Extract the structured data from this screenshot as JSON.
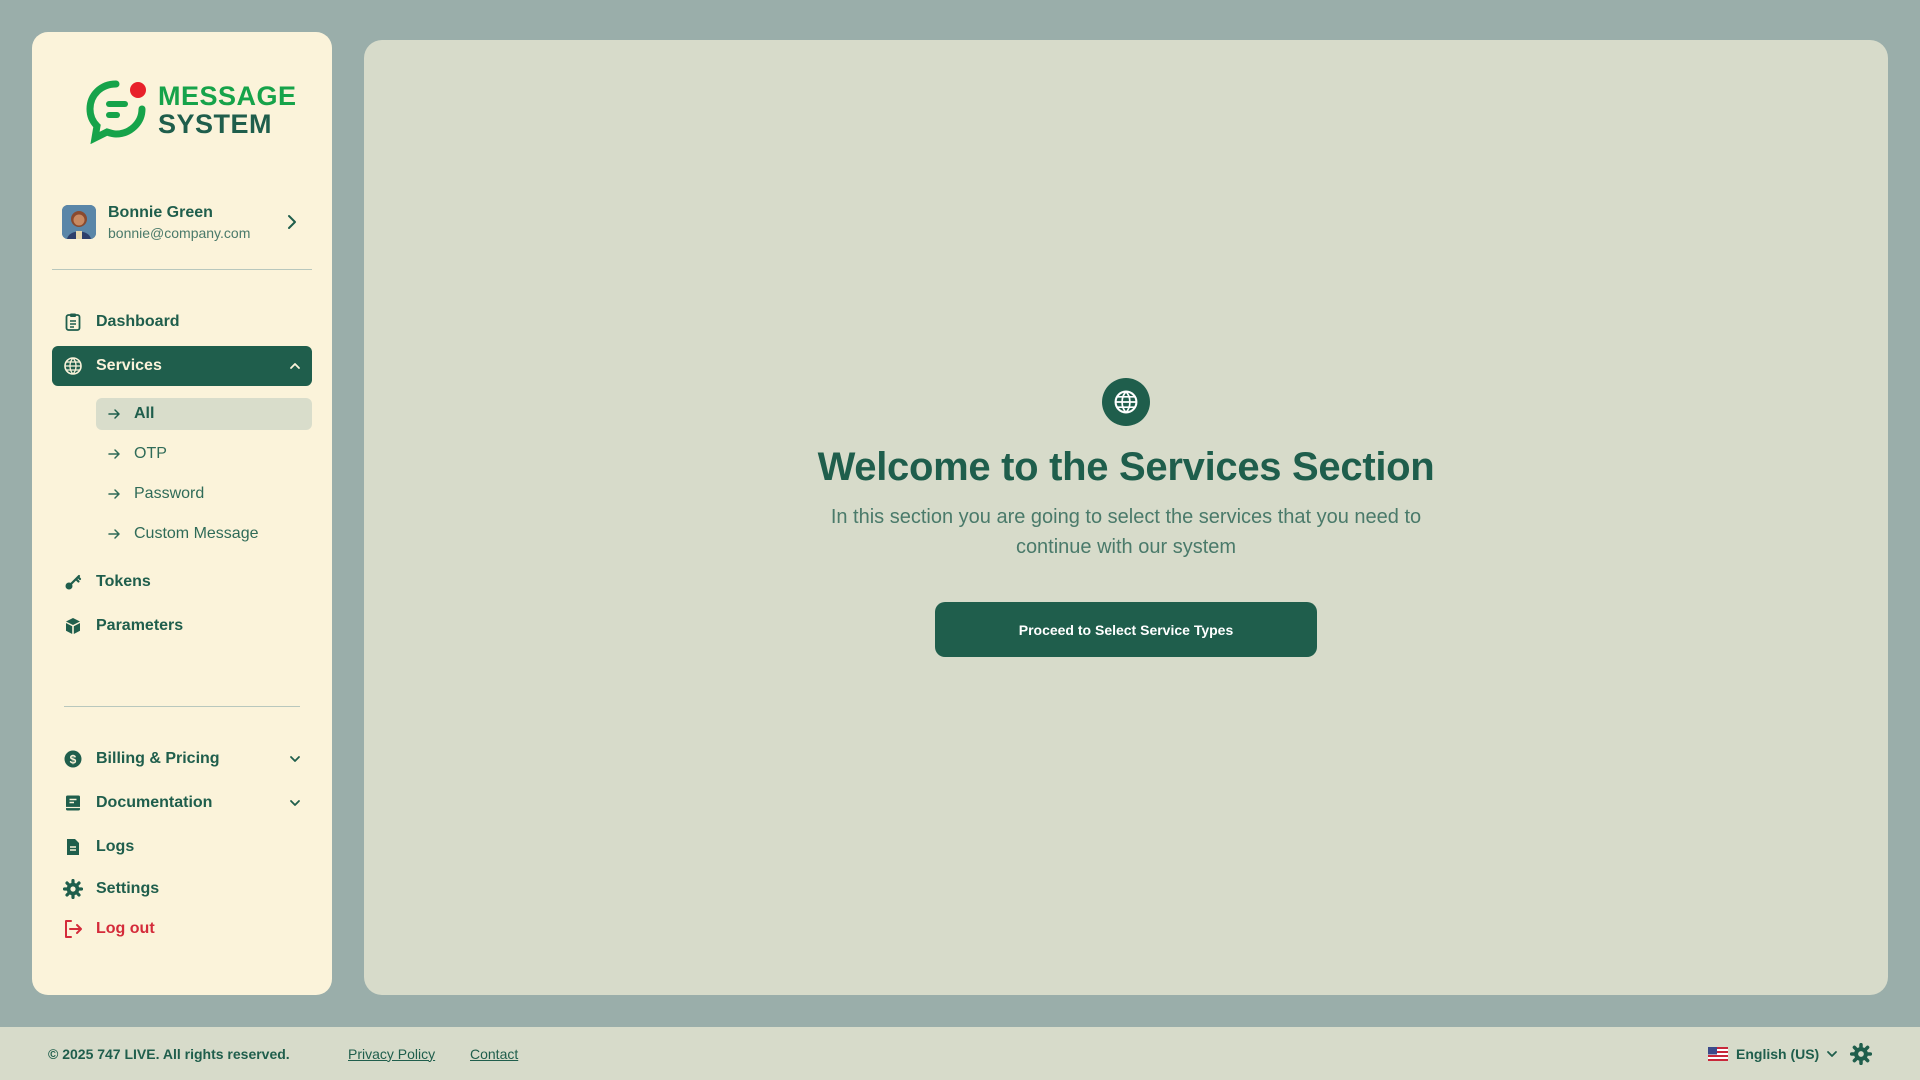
{
  "brand": {
    "line1": "MESSAGE",
    "line2": "SYSTEM"
  },
  "user": {
    "name": "Bonnie Green",
    "email": "bonnie@company.com"
  },
  "nav": {
    "dashboard": "Dashboard",
    "services": "Services",
    "services_sub": [
      "All",
      "OTP",
      "Password",
      "Custom Message"
    ],
    "tokens": "Tokens",
    "parameters": "Parameters",
    "billing": "Billing & Pricing",
    "documentation": "Documentation",
    "logs": "Logs",
    "settings": "Settings",
    "logout": "Log out"
  },
  "main": {
    "title": "Welcome to the Services Section",
    "subtitle": "In this section you are going to select the services that you need to continue with our system",
    "cta": "Proceed to Select Service Types"
  },
  "footer": {
    "copyright": "© 2025 747 LIVE. All rights reserved.",
    "privacy": "Privacy Policy",
    "contact": "Contact",
    "language": "English (US)"
  },
  "colors": {
    "primary": "#1f5e4c",
    "brand_green": "#16a34a",
    "logout_red": "#d42b3a",
    "sidebar_bg": "#fbf3da",
    "main_bg": "#d7dbca"
  },
  "icons": [
    "clipboard-icon",
    "globe-icon",
    "chevron-up-icon",
    "arrow-right-icon",
    "key-icon",
    "cube-icon",
    "dollar-circle-icon",
    "chevron-down-icon",
    "book-icon",
    "document-icon",
    "gear-icon",
    "logout-icon",
    "flag-us-icon"
  ]
}
